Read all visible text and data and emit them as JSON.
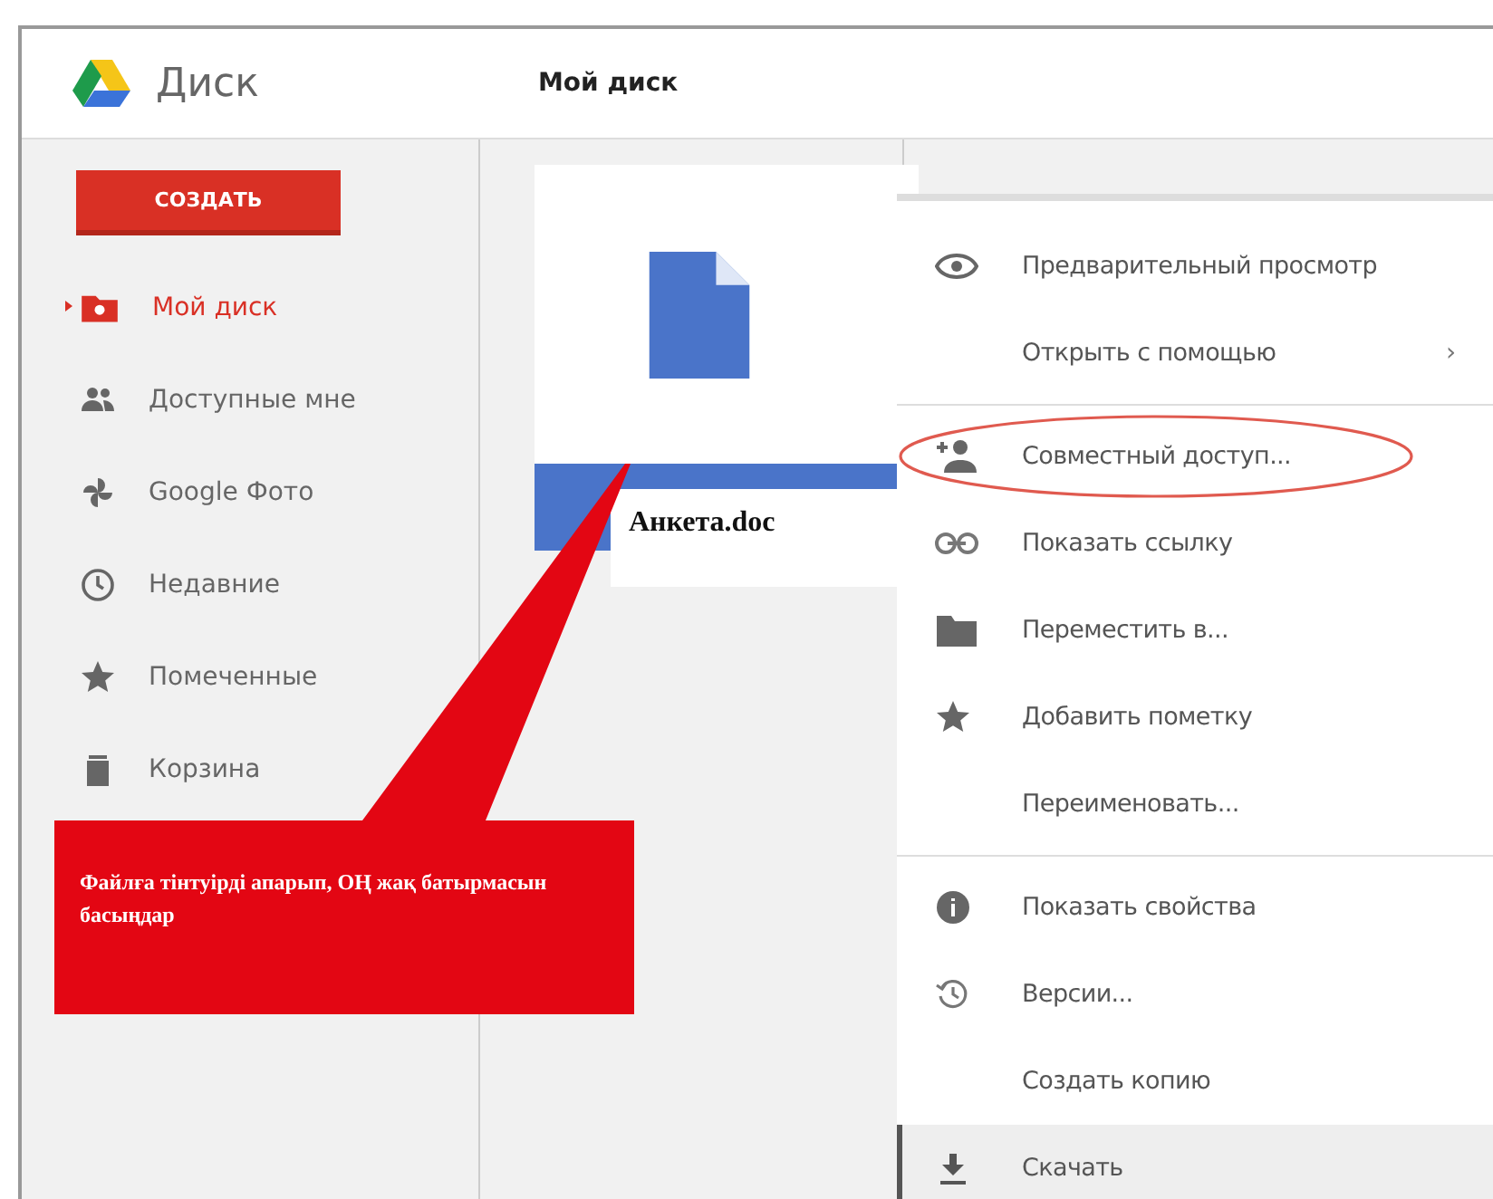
{
  "app": {
    "name": "Диск"
  },
  "header": {
    "title": "Мой диск"
  },
  "create_button": "СОЗДАТЬ",
  "sidebar": {
    "items": [
      {
        "label": "Мой диск",
        "kind": "drive",
        "selected": true
      },
      {
        "label": "Доступные мне",
        "kind": "people",
        "selected": false
      },
      {
        "label": "Google Фото",
        "kind": "pinwheel",
        "selected": false
      },
      {
        "label": "Недавние",
        "kind": "clock",
        "selected": false
      },
      {
        "label": "Помеченные",
        "kind": "star",
        "selected": false
      },
      {
        "label": "Корзина",
        "kind": "trash",
        "selected": false
      }
    ]
  },
  "file": {
    "name": "Анкета.doc",
    "selected": true
  },
  "context_menu": {
    "groups": [
      [
        {
          "label": "Предварительный просмотр",
          "kind": "eye",
          "submenu": false,
          "selected": false,
          "circled": false
        },
        {
          "label": "Открыть с помощью",
          "kind": "plain",
          "submenu": true,
          "selected": false,
          "circled": false
        }
      ],
      [
        {
          "label": "Совместный доступ...",
          "kind": "person-add",
          "submenu": false,
          "selected": false,
          "circled": true
        },
        {
          "label": "Показать ссылку",
          "kind": "link",
          "submenu": false,
          "selected": false,
          "circled": false
        },
        {
          "label": "Переместить в...",
          "kind": "folder",
          "submenu": false,
          "selected": false,
          "circled": false
        },
        {
          "label": "Добавить пометку",
          "kind": "star",
          "submenu": false,
          "selected": false,
          "circled": false
        },
        {
          "label": "Переименовать...",
          "kind": "plain",
          "submenu": false,
          "selected": false,
          "circled": false
        }
      ],
      [
        {
          "label": "Показать свойства",
          "kind": "info",
          "submenu": false,
          "selected": false,
          "circled": false
        },
        {
          "label": "Версии...",
          "kind": "history",
          "submenu": false,
          "selected": false,
          "circled": false
        },
        {
          "label": "Создать копию",
          "kind": "plain",
          "submenu": false,
          "selected": false,
          "circled": false
        },
        {
          "label": "Скачать",
          "kind": "download",
          "submenu": false,
          "selected": true,
          "circled": false
        }
      ]
    ]
  },
  "submenu_arrow": "›",
  "callout": {
    "text": "Файлға тінтуірді апарып, ОҢ жақ батырмасын басыңдар"
  }
}
